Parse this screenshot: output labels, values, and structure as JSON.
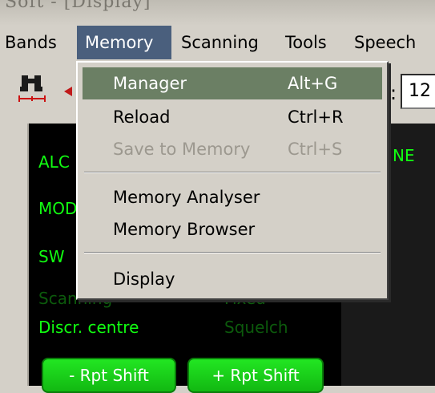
{
  "window": {
    "title": "Soft - [Display]"
  },
  "menubar": {
    "items": [
      {
        "label": "Bands"
      },
      {
        "label": "Memory"
      },
      {
        "label": "Scanning"
      },
      {
        "label": "Tools"
      },
      {
        "label": "Speech"
      }
    ]
  },
  "toolbar": {
    "field_label": ":",
    "field_value": "12",
    "icons": [
      "binoculars-icon",
      "red-tool-icon"
    ]
  },
  "memory_menu": {
    "items": [
      {
        "label": "Manager",
        "shortcut": "Alt+G",
        "state": "highlighted"
      },
      {
        "label": "Reload",
        "shortcut": "Ctrl+R",
        "state": "enabled"
      },
      {
        "label": "Save to Memory",
        "shortcut": "Ctrl+S",
        "state": "disabled"
      },
      {
        "label": "Memory Analyser",
        "shortcut": "",
        "state": "enabled"
      },
      {
        "label": "Memory Browser",
        "shortcut": "",
        "state": "enabled"
      },
      {
        "label": "Display",
        "shortcut": "",
        "state": "enabled"
      }
    ]
  },
  "panel": {
    "labels": {
      "alc": "ALC",
      "mode": "MOD",
      "sw": "SW",
      "right_ne": "NE",
      "scanning": "Scanning",
      "discr": "Discr. centre",
      "fixed": "Fixed",
      "squelch": "Squelch"
    },
    "buttons": {
      "minus_rpt": "- Rpt Shift",
      "plus_rpt": "+ Rpt Shift"
    }
  },
  "colors": {
    "menu_highlight": "#4a5f7d",
    "item_highlight": "#6b7f64",
    "panel_text": "#11ff11",
    "panel_bg": "#000000"
  }
}
